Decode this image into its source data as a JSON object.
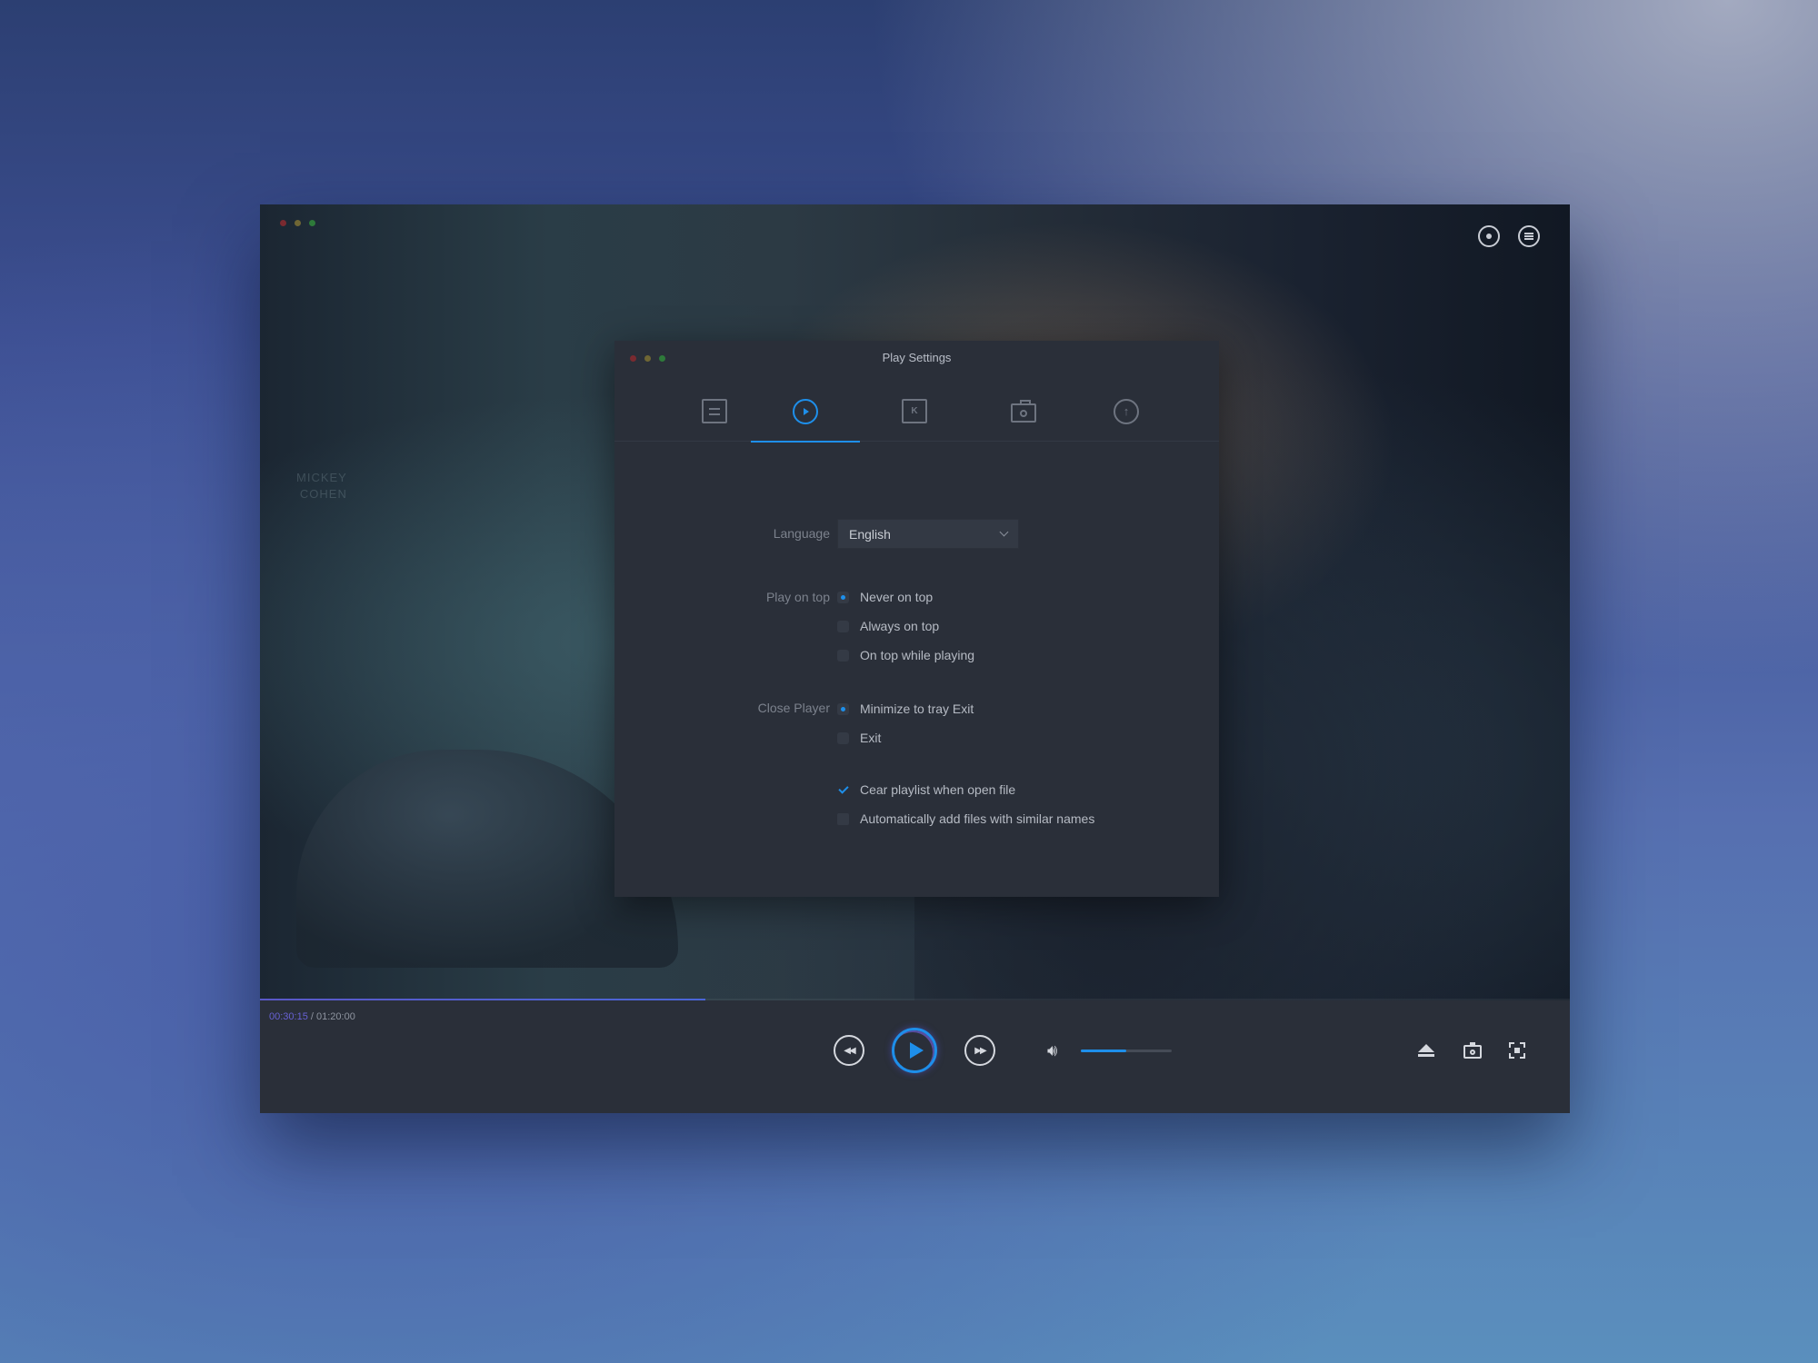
{
  "player": {
    "poster_text": [
      "MICKEY",
      "COHEN"
    ],
    "top_icons": [
      "user-icon",
      "menu-icon"
    ]
  },
  "dialog": {
    "title": "Play Settings",
    "tabs": [
      {
        "icon": "sliders-icon",
        "active": false
      },
      {
        "icon": "play-circle-icon",
        "active": true
      },
      {
        "icon": "k-box-icon",
        "label": "K",
        "active": false
      },
      {
        "icon": "camera-icon",
        "active": false
      },
      {
        "icon": "upload-icon",
        "active": false
      }
    ],
    "language": {
      "label": "Language",
      "value": "English"
    },
    "play_on_top": {
      "label": "Play on top",
      "options": [
        {
          "label": "Never on top",
          "selected": true
        },
        {
          "label": "Always on top",
          "selected": false
        },
        {
          "label": "On top while playing",
          "selected": false
        }
      ]
    },
    "close_player": {
      "label": "Close Player",
      "options": [
        {
          "label": "Minimize to tray Exit",
          "selected": true
        },
        {
          "label": "Exit",
          "selected": false
        }
      ]
    },
    "checkboxes": [
      {
        "label": "Cear playlist when open file",
        "checked": true
      },
      {
        "label": "Automatically add files with similar names",
        "checked": false
      }
    ]
  },
  "controls": {
    "current_time": "00:30:15",
    "separator": " / ",
    "total_time": "01:20:00",
    "progress_percent": 34,
    "volume_percent": 50
  },
  "colors": {
    "accent": "#1e8fea",
    "progress": "#5a58c8",
    "panel": "#2a2f39"
  }
}
